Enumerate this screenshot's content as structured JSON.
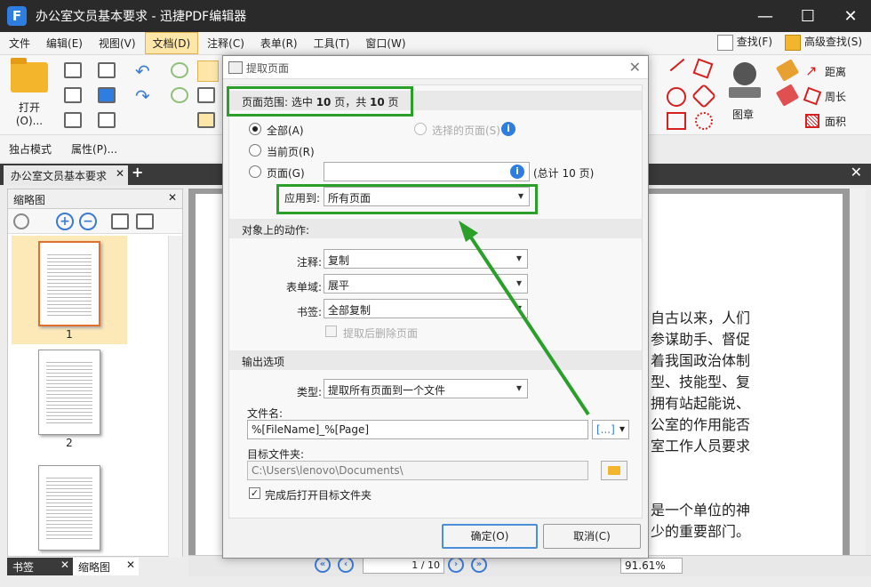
{
  "app": {
    "logo_letter": "F",
    "title": "办公室文员基本要求 - 迅捷PDF编辑器",
    "ctrl_min": "—",
    "ctrl_max": "☐",
    "ctrl_close": "✕"
  },
  "menu": {
    "items": [
      "文件",
      "编辑(E)",
      "视图(V)",
      "文档(D)",
      "注释(C)",
      "表单(R)",
      "工具(T)",
      "窗口(W)"
    ],
    "active_index": 3,
    "find": "查找(F)",
    "advanced_find": "高级查找(S)"
  },
  "toolbar": {
    "open": "打开(O)...",
    "stamp": "图章",
    "distance": "距离",
    "perimeter": "周长",
    "area": "面积",
    "exclusive_mode": "独占模式",
    "properties": "属性(P)..."
  },
  "tabs": {
    "doc_tab": "办公室文员基本要求",
    "close_glyph": "✕",
    "add_glyph": "+",
    "close_all_glyph": "✕"
  },
  "left_panel": {
    "title": "缩略图",
    "close_glyph": "✕",
    "thumbs": [
      "1",
      "2",
      ""
    ],
    "bottom_tabs": [
      "书签",
      "缩略图"
    ]
  },
  "document": {
    "lines": [
      "自古以来，人们",
      "参谋助手、督促",
      "着我国政治体制",
      "型、技能型、复",
      "拥有站起能说、",
      "公室的作用能否",
      "室工作人员要求",
      "",
      "是一个单位的神",
      "少的重要部门。"
    ]
  },
  "statusbar": {
    "page_current": "1",
    "page_total": "/ 10",
    "zoom": "91.61%"
  },
  "dialog": {
    "title": "提取页面",
    "close_glyph": "✕",
    "range_summary_prefix": "页面范围: 选中 ",
    "range_selected": "10",
    "range_summary_mid": " 页，共 ",
    "range_total": "10",
    "range_summary_suffix": " 页",
    "radio_all": "全部(A)",
    "radio_selected_pages": "选择的页面(S)",
    "radio_current": "当前页(R)",
    "radio_pages": "页面(G)",
    "pages_input_value": "",
    "pages_total_note": "(总计 10 页)",
    "apply_to_label": "应用到:",
    "apply_to_value": "所有页面",
    "actions_section": "对象上的动作:",
    "annot_label": "注释:",
    "annot_value": "复制",
    "form_label": "表单域:",
    "form_value": "展平",
    "bookmark_label": "书签:",
    "bookmark_value": "全部复制",
    "delete_after": "提取后删除页面",
    "output_section": "输出选项",
    "type_label": "类型:",
    "type_value": "提取所有页面到一个文件",
    "filename_label": "文件名:",
    "filename_value": "%[FileName]_%[Page]",
    "browse_label": "[...]",
    "target_folder_label": "目标文件夹:",
    "target_folder_value": "C:\\Users\\lenovo\\Documents\\",
    "open_after": "完成后打开目标文件夹",
    "ok_button": "确定(O)",
    "cancel_button": "取消(C)",
    "check_glyph": "✓",
    "info_glyph": "i"
  },
  "colors": {
    "highlight_green": "#2aa02a",
    "accent_blue": "#2e7de0",
    "active_menu": "#fde6a8"
  }
}
